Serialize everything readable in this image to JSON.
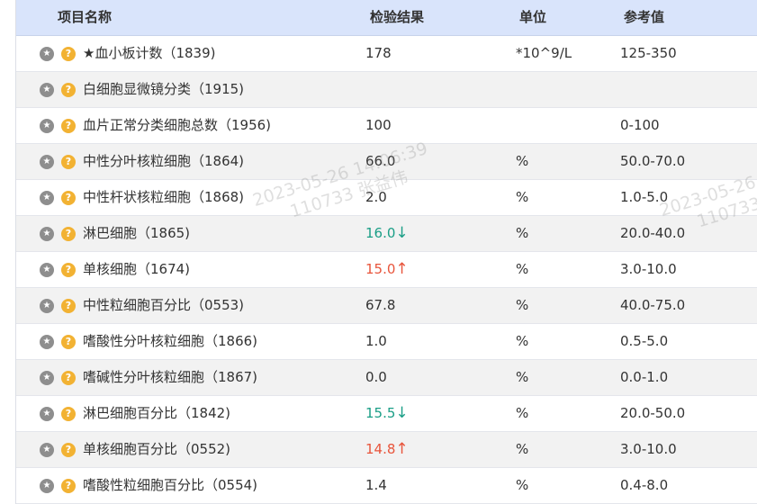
{
  "table": {
    "headers": {
      "name": "项目名称",
      "result": "检验结果",
      "unit": "单位",
      "ref": "参考值"
    },
    "rows": [
      {
        "name": "★血小板计数（1839)",
        "result": "178",
        "flag": "",
        "unit": "*10^9/L",
        "ref": "125-350"
      },
      {
        "name": "白细胞显微镜分类（1915)",
        "result": "",
        "flag": "",
        "unit": "",
        "ref": ""
      },
      {
        "name": "血片正常分类细胞总数（1956)",
        "result": "100",
        "flag": "",
        "unit": "",
        "ref": "0-100"
      },
      {
        "name": "中性分叶核粒细胞（1864)",
        "result": "66.0",
        "flag": "",
        "unit": "%",
        "ref": "50.0-70.0"
      },
      {
        "name": "中性杆状核粒细胞（1868)",
        "result": "2.0",
        "flag": "",
        "unit": "%",
        "ref": "1.0-5.0"
      },
      {
        "name": "淋巴细胞（1865)",
        "result": "16.0",
        "flag": "↓",
        "unit": "%",
        "ref": "20.0-40.0"
      },
      {
        "name": "单核细胞（1674)",
        "result": "15.0",
        "flag": "↑",
        "unit": "%",
        "ref": "3.0-10.0"
      },
      {
        "name": "中性粒细胞百分比（0553)",
        "result": "67.8",
        "flag": "",
        "unit": "%",
        "ref": "40.0-75.0"
      },
      {
        "name": "嗜酸性分叶核粒细胞（1866)",
        "result": "1.0",
        "flag": "",
        "unit": "%",
        "ref": "0.5-5.0"
      },
      {
        "name": "嗜碱性分叶核粒细胞（1867)",
        "result": "0.0",
        "flag": "",
        "unit": "%",
        "ref": "0.0-1.0"
      },
      {
        "name": "淋巴细胞百分比（1842)",
        "result": "15.5",
        "flag": "↓",
        "unit": "%",
        "ref": "20.0-50.0"
      },
      {
        "name": "单核细胞百分比（0552)",
        "result": "14.8",
        "flag": "↑",
        "unit": "%",
        "ref": "3.0-10.0"
      },
      {
        "name": "嗜酸性粒细胞百分比（0554)",
        "result": "1.4",
        "flag": "",
        "unit": "%",
        "ref": "0.4-8.0"
      }
    ]
  },
  "icons": {
    "star": "star-icon",
    "help": "question-mark-icon",
    "star_glyph": "★",
    "help_glyph": "?"
  },
  "watermark": {
    "line1": "2023-05-26 14:06:39",
    "line2": "110733 张益伟",
    "right_line1": "2023-05-26",
    "right_line2": "110733"
  },
  "colors": {
    "header_bg": "#d9e4fb",
    "low": "#1a9e86",
    "high": "#e8553c",
    "help_icon": "#f2b233",
    "star_icon": "#8e8e8e"
  }
}
